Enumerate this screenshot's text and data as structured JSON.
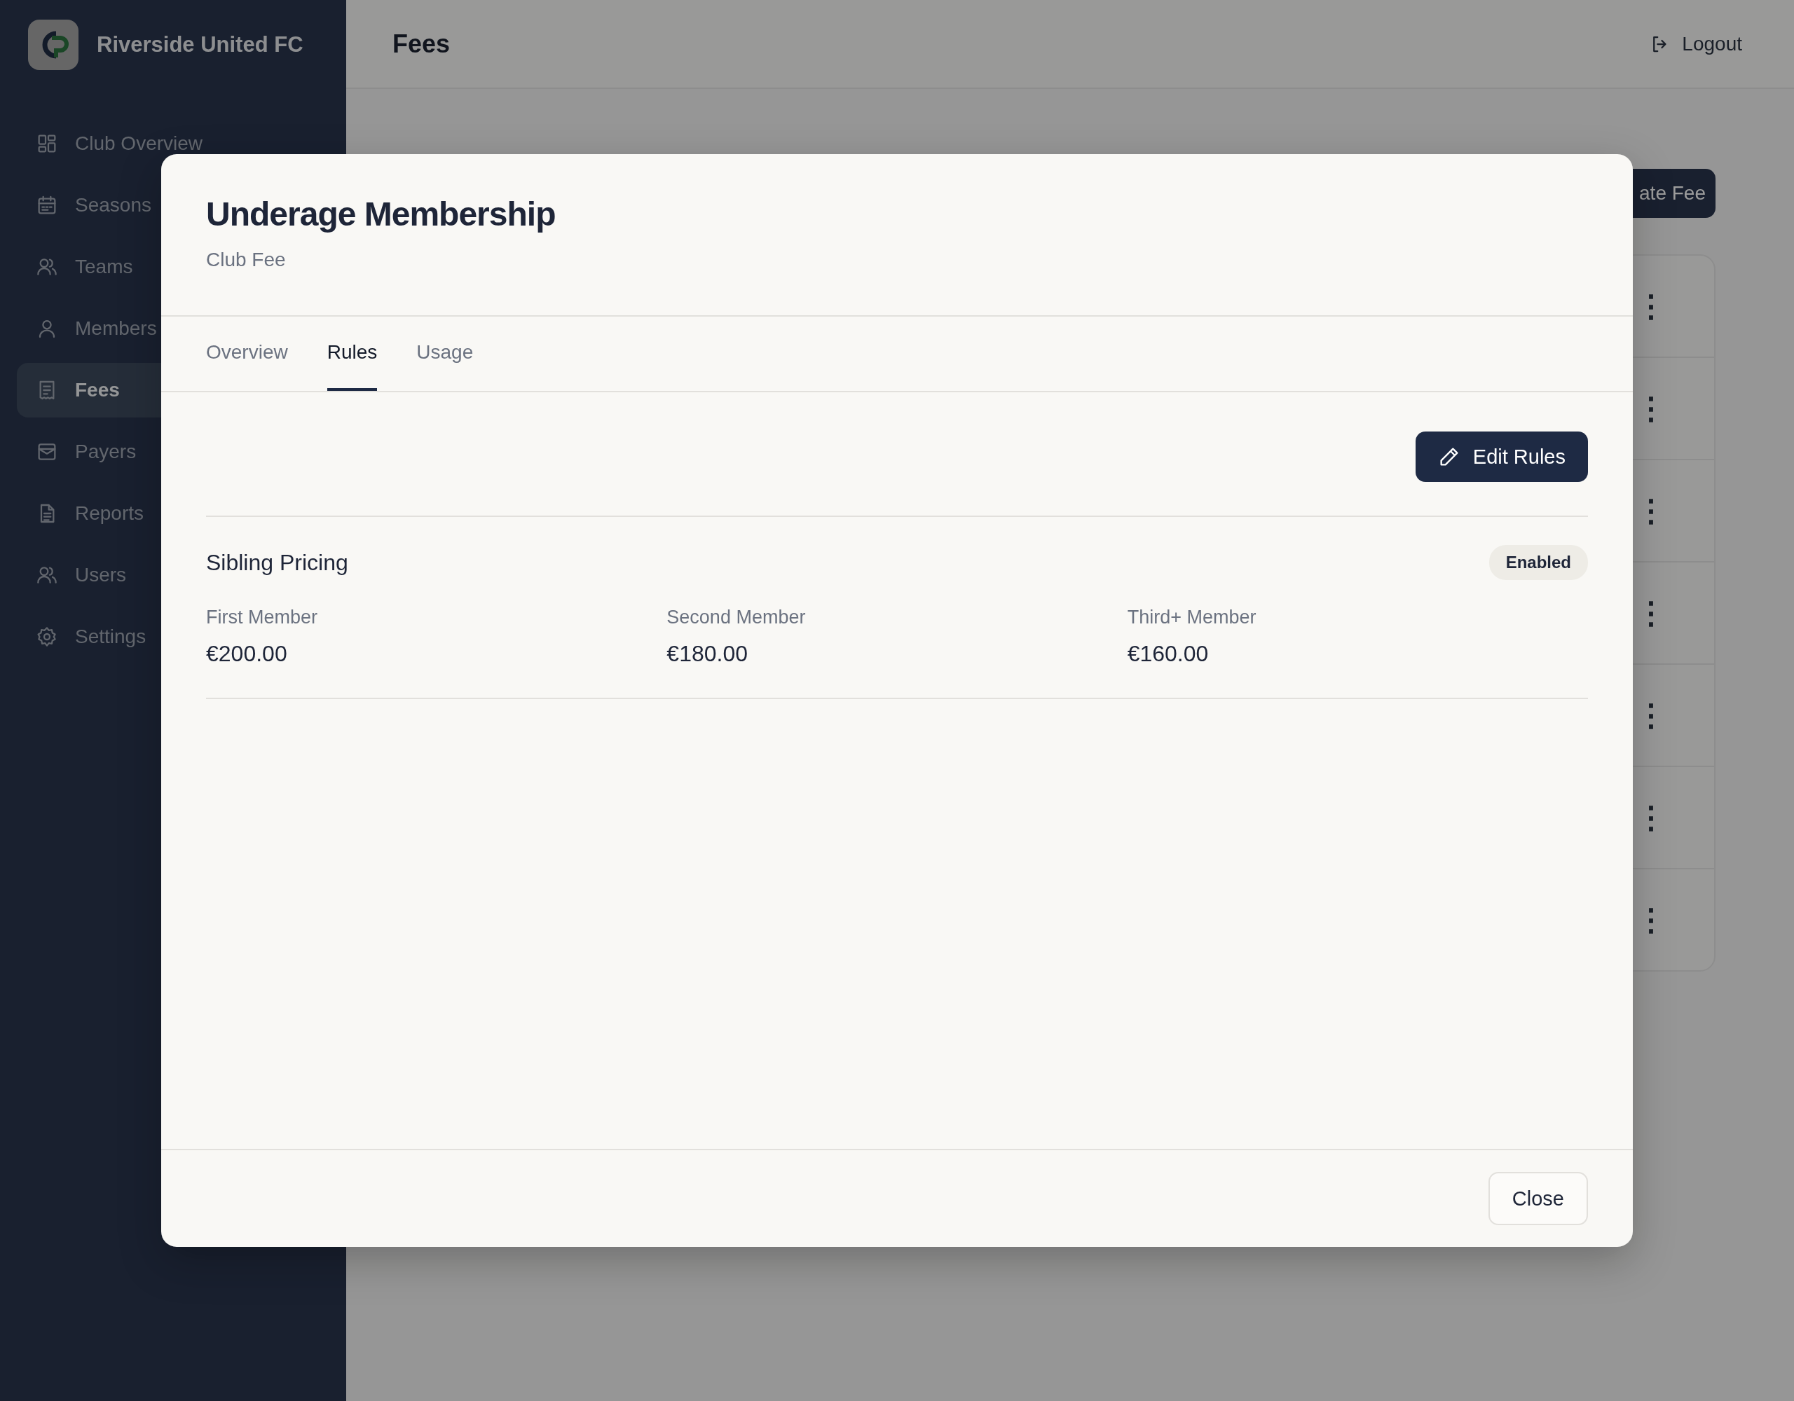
{
  "app": {
    "name": "Riverside United FC"
  },
  "sidebar": {
    "items": [
      {
        "label": "Club Overview",
        "selected": false
      },
      {
        "label": "Seasons",
        "selected": false
      },
      {
        "label": "Teams",
        "selected": false
      },
      {
        "label": "Members",
        "selected": false
      },
      {
        "label": "Fees",
        "selected": true
      },
      {
        "label": "Payers",
        "selected": false
      },
      {
        "label": "Reports",
        "selected": false
      },
      {
        "label": "Users",
        "selected": false
      },
      {
        "label": "Settings",
        "selected": false
      }
    ]
  },
  "header": {
    "title": "Fees",
    "logout": "Logout"
  },
  "page": {
    "create_button": "ate Fee",
    "rows": [
      {
        "menu": "⋮"
      },
      {
        "menu": "⋮"
      },
      {
        "menu": "⋮"
      },
      {
        "menu": "⋮"
      },
      {
        "menu": "⋮"
      },
      {
        "menu": "⋮"
      },
      {
        "menu": "⋮"
      }
    ]
  },
  "modal": {
    "title": "Underage Membership",
    "subtitle": "Club Fee",
    "tabs": [
      {
        "label": "Overview",
        "selected": false
      },
      {
        "label": "Rules",
        "selected": true
      },
      {
        "label": "Usage",
        "selected": false
      }
    ],
    "edit_button": "Edit Rules",
    "rule": {
      "title": "Sibling Pricing",
      "status": "Enabled",
      "enabled": true,
      "tiers": [
        {
          "label": "First Member",
          "value": "€200.00"
        },
        {
          "label": "Second Member",
          "value": "€180.00"
        },
        {
          "label": "Third+ Member",
          "value": "€160.00"
        }
      ]
    },
    "close_button": "Close"
  }
}
